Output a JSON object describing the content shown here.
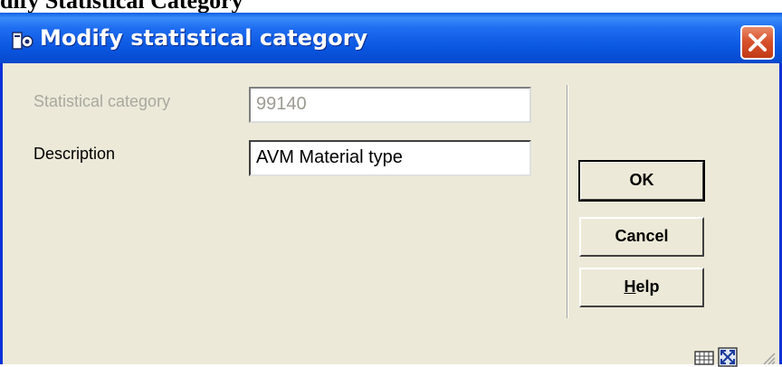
{
  "page": {
    "heading_fragment": "dify Statistical Category"
  },
  "window": {
    "title": "Modify statistical category",
    "app_icon": "library-app-icon",
    "close_icon": "close-icon"
  },
  "form": {
    "statistical_category": {
      "label": "Statistical category",
      "value": "99140",
      "enabled": false
    },
    "description": {
      "label": "Description",
      "value": "AVM Material type",
      "enabled": true
    }
  },
  "buttons": {
    "ok": "OK",
    "cancel": "Cancel",
    "help_first": "H",
    "help_rest": "elp"
  },
  "status_icons": [
    "keyboard-grid-icon",
    "expand-window-icon",
    "resize-grip-icon"
  ],
  "colors": {
    "titlebar": "#0a56e0",
    "close_button": "#d8532d",
    "dialog_background": "#ece9d8",
    "disabled_text": "#a9a89f"
  }
}
